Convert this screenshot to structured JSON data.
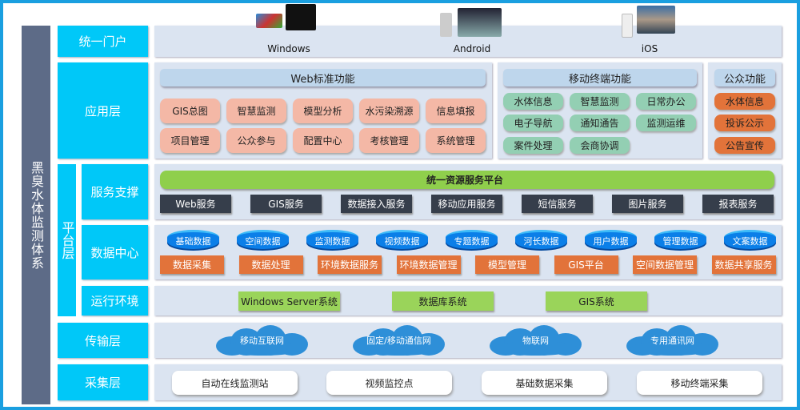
{
  "system_title": "黑臭水体监测体系",
  "layers": {
    "portal": "统一门户",
    "application": "应用层",
    "platform": "平台层",
    "service": "服务支撑",
    "datacenter": "数据中心",
    "runtime": "运行环境",
    "transport": "传输层",
    "collection": "采集层"
  },
  "portal": {
    "platforms": [
      "Windows",
      "Android",
      "iOS"
    ]
  },
  "application": {
    "web": {
      "title": "Web标准功能",
      "items": [
        "GIS总图",
        "智慧监测",
        "模型分析",
        "水污染溯源",
        "信息填报",
        "项目管理",
        "公众参与",
        "配置中心",
        "考核管理",
        "系统管理"
      ]
    },
    "mobile": {
      "title": "移动终端功能",
      "items": [
        "水体信息",
        "智慧监测",
        "日常办公",
        "电子导航",
        "通知通告",
        "监测运维",
        "案件处理",
        "会商协调"
      ]
    },
    "public": {
      "title": "公众功能",
      "items": [
        "水体信息",
        "投诉公示",
        "公告宣传"
      ]
    }
  },
  "service": {
    "platform": "统一资源服务平台",
    "items": [
      "Web服务",
      "GIS服务",
      "数据接入服务",
      "移动应用服务",
      "短信服务",
      "图片服务",
      "报表服务"
    ]
  },
  "datacenter": {
    "databases": [
      "基础数据",
      "空间数据",
      "监测数据",
      "视频数据",
      "专题数据",
      "河长数据",
      "用户数据",
      "管理数据",
      "文案数据"
    ],
    "functions": [
      "数据采集",
      "数据处理",
      "环境数据服务",
      "环境数据管理",
      "模型管理",
      "GIS平台",
      "空间数据管理",
      "数据共享服务"
    ]
  },
  "runtime": {
    "items": [
      "Windows Server系统",
      "数据库系统",
      "GIS系统"
    ]
  },
  "transport": {
    "items": [
      "移动互联网",
      "固定/移动通信网",
      "物联网",
      "专用通讯网"
    ]
  },
  "collection": {
    "items": [
      "自动在线监测站",
      "视频监控点",
      "基础数据采集",
      "移动终端采集"
    ]
  },
  "colors": {
    "frame": "#1a9fe0",
    "label": "#00c8f8",
    "sidebar": "#5d6b87",
    "green": "#9ad45a",
    "orange": "#e2733a",
    "pink": "#f4b8a6",
    "dark": "#363e4b",
    "db": "#0b7fe8"
  }
}
